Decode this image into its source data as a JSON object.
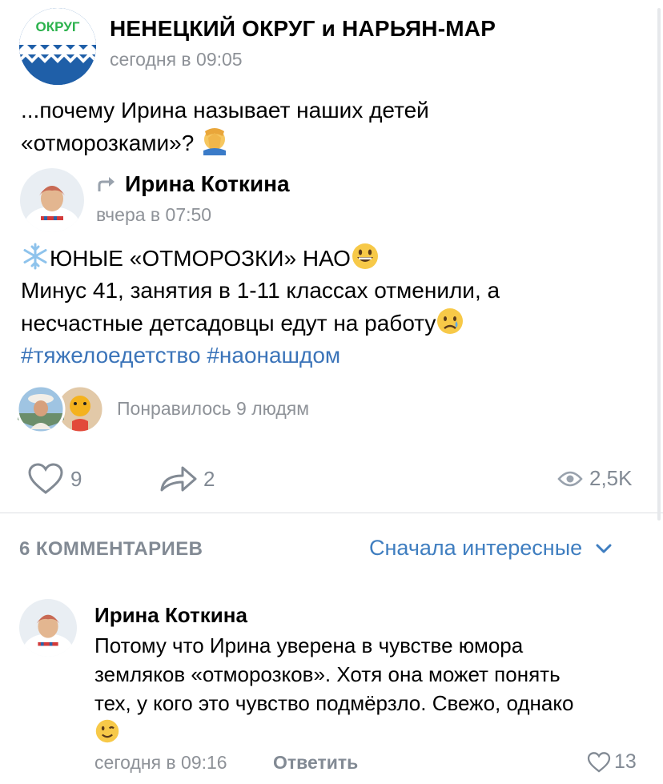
{
  "post": {
    "group_name": "НЕНЕЦКИЙ ОКРУГ и НАРЬЯН-МАР",
    "group_logo_text": "ОКРУГ",
    "time": "сегодня в 09:05",
    "text_line1": "...почему Ирина называет наших детей",
    "text_line2": "«отморозками»?"
  },
  "repost": {
    "author": "Ирина Коткина",
    "time": "вчера в 07:50",
    "title": "ЮНЫЕ «ОТМОРОЗКИ» НАО",
    "line2": "Минус 41, занятия в 1-11 классах отменили, а",
    "line3": "несчастные детсадовцы едут на работу",
    "hashtags": "#тяжелоедетство #наонашдом"
  },
  "reactions": {
    "liked_by": "Понравилось 9 людям",
    "likes": "9",
    "shares": "2",
    "views": "2,5K"
  },
  "comments": {
    "count_label": "6 КОММЕНТАРИЕВ",
    "sort_label": "Сначала интересные",
    "items": [
      {
        "author": "Ирина Коткина",
        "line1": "Потому что Ирина уверена в чувстве юмора",
        "line2": "земляков «отморозков». Хотя она может понять",
        "line3": "тех, у кого это чувство подмёрзло. Свежо, однако",
        "time": "сегодня в 09:16",
        "reply": "Ответить",
        "likes": "13"
      }
    ]
  },
  "colors": {
    "link": "#3f7ec0",
    "secondary": "#828a94",
    "brand": "#1f5fa8"
  }
}
